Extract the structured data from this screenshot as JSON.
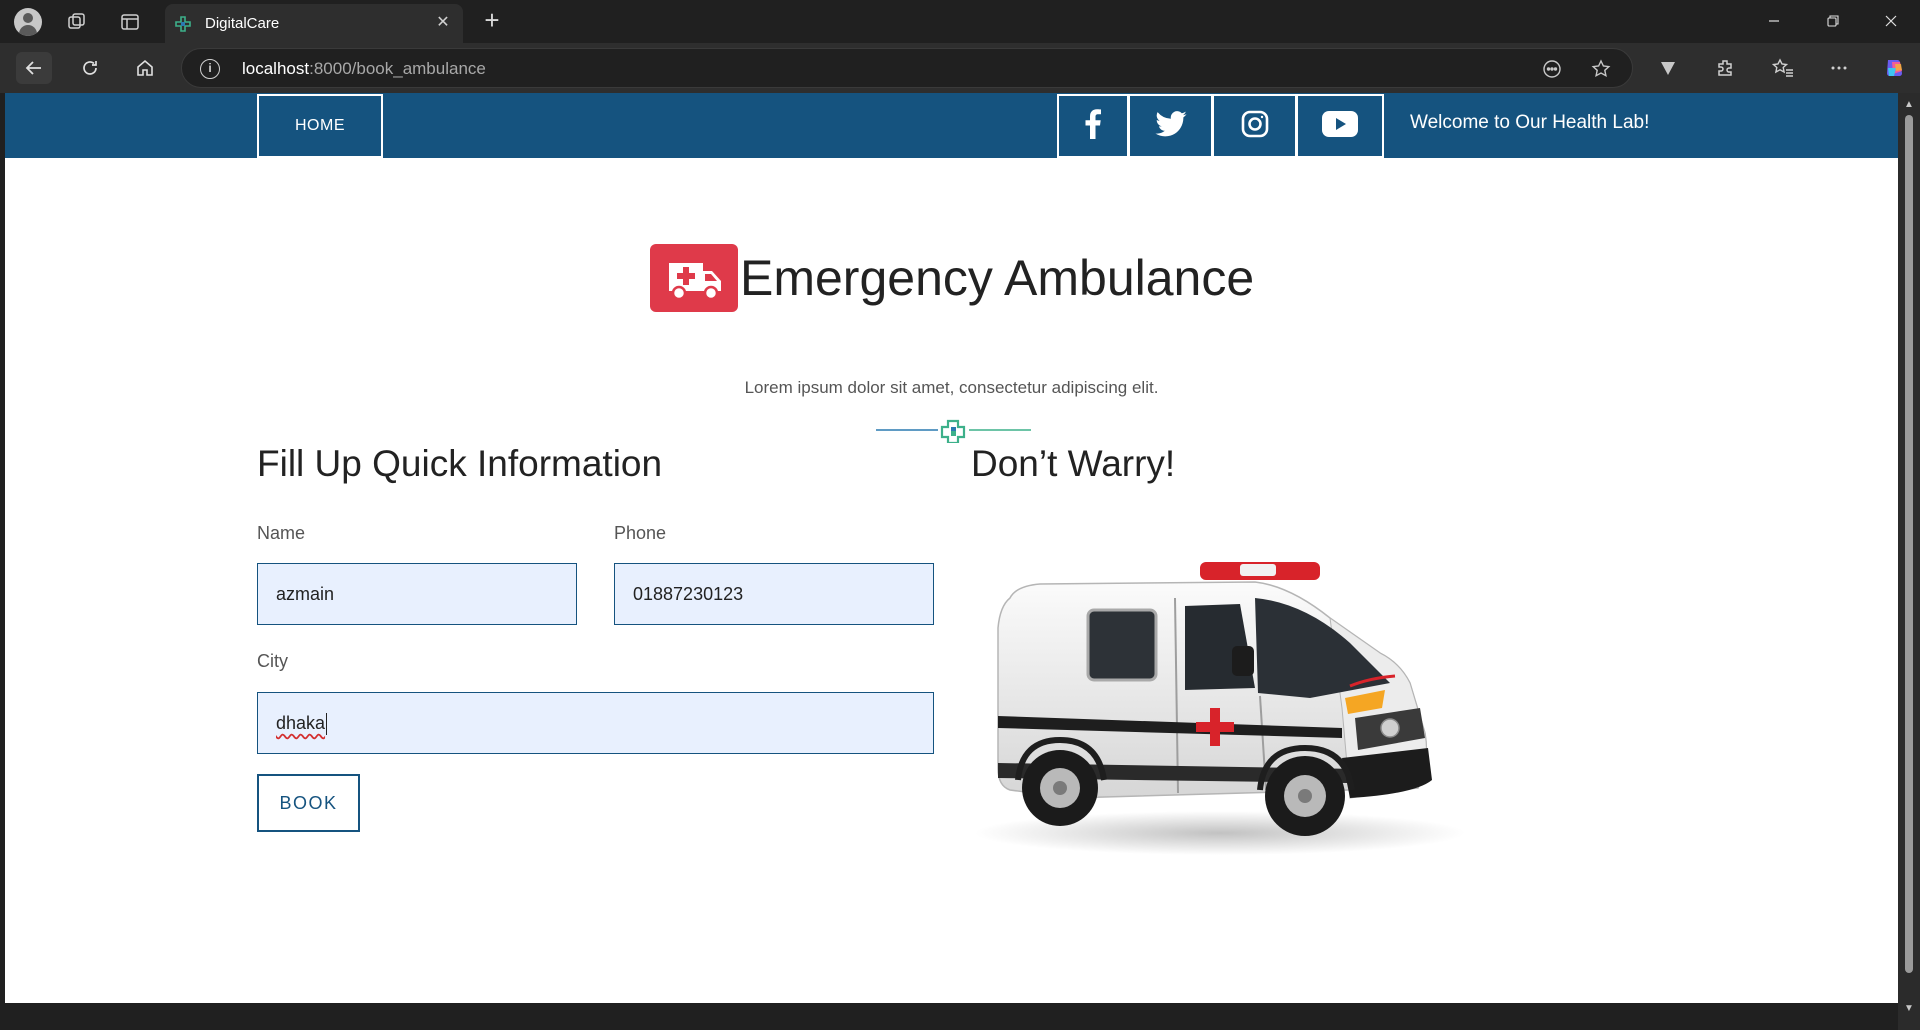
{
  "browser": {
    "tab_title": "DigitalCare",
    "url_host": "localhost",
    "url_path": ":8000/book_ambulance"
  },
  "header": {
    "home_label": "HOME",
    "social": [
      "facebook-icon",
      "twitter-icon",
      "instagram-icon",
      "youtube-icon"
    ],
    "welcome_text": "Welcome to Our Health Lab!"
  },
  "hero": {
    "title": "Emergency Ambulance",
    "subtitle": "Lorem ipsum dolor sit amet, consectetur adipiscing elit."
  },
  "form": {
    "heading": "Fill Up Quick Information",
    "name_label": "Name",
    "name_value": "azmain",
    "phone_label": "Phone",
    "phone_value": "01887230123",
    "city_label": "City",
    "city_value": "dhaka",
    "book_label": "BOOK"
  },
  "aside": {
    "heading": "Don’t Warry!"
  },
  "colors": {
    "header_bg": "#15537f",
    "badge_red": "#df3a4a",
    "field_bg": "#e8f0fe",
    "divider_green": "#3db08a"
  }
}
